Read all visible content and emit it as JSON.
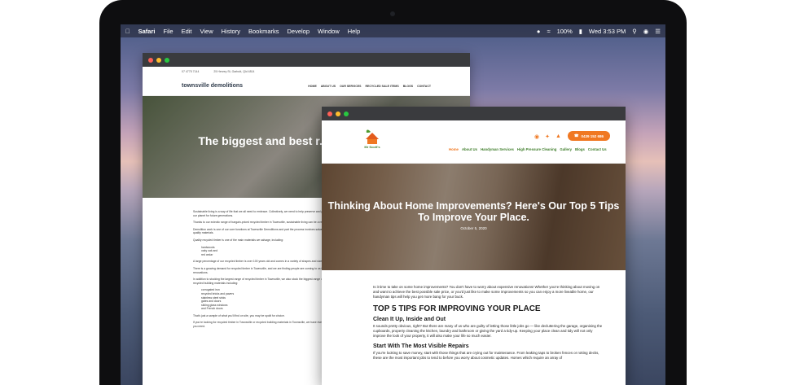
{
  "menubar": {
    "app": "Safari",
    "items": [
      "File",
      "Edit",
      "View",
      "History",
      "Bookmarks",
      "Develop",
      "Window",
      "Help"
    ],
    "battery": "100%",
    "clock": "Wed 3:53 PM"
  },
  "back_window": {
    "phone": "07 4775 7144",
    "address": "25 Hervey St, Garbutt, Qld 4814",
    "logo": "townsville demolitions",
    "nav": [
      "HOME",
      "ABOUT US",
      "OUR SERVICES",
      "RECYCLED SALE ITEMS",
      "BLOGS",
      "CONTACT"
    ],
    "hero_title": "The biggest and best r... timber in Tow...",
    "paragraphs": [
      "Sustainable living is a way of life that we all need to embrace. Collectively, we need to help preserve and protect our planet for future generations.",
      "Thanks to our eclectic range of bargain-priced recycled timber in Townsville, sustainable living can be a reality.",
      "Demolition work is one of our core functions at Townsville Demolitions and part the process involves salvaging quality materials.",
      "Quality recycled timber is one of the main materials we salvage, including:"
    ],
    "list1": [
      "hardwoods",
      "oaky oak and",
      "red cedar"
    ],
    "paragraphs2": [
      "A large percentage of our recycled timber is over 100 years old and comes in a variety of shapes and sizes.",
      "There is a growing demand for recycled timber in Townsville, and we are finding people are coming to us for new renovations.",
      "In addition to stocking the largest range of recycled timber in Townsville, we also stock the biggest range of recycled building materials including:"
    ],
    "list2": [
      "corrugated iron",
      "recycled bricks and pavers",
      "stainless steel sinks",
      "gates and doors",
      "sliding glass windows",
      "and French doors"
    ],
    "footer_text": "That's just a sample of what you'll find on site, you may be spoilt for choice.",
    "footer_text2": "If you're looking for recycled timber in Townsville or recycled building materials in Townsville, we have everything you need."
  },
  "front_window": {
    "logo_text": "Mr Scott's",
    "social_icons": [
      "instagram-icon",
      "twitter-icon",
      "houzz-icon"
    ],
    "phone": "0439 152 686",
    "nav": [
      "Home",
      "About Us",
      "Handyman Services",
      "High Pressure Cleaning",
      "Gallery",
      "Blogs",
      "Contact Us"
    ],
    "hero_title": "Thinking About Home Improvements? Here's Our Top 5 Tips To Improve Your Place.",
    "hero_date": "October 5, 2020",
    "intro": "Is it time to take on some home improvements? You don't have to worry about expensive renovations! Whether you're thinking about moving on and want to achieve the best possible sale price, or you'd just like to make some improvements so you can enjoy a more liveable home, our handyman tips will help you get more bang for your buck.",
    "h2": "TOP 5 TIPS FOR IMPROVING YOUR PLACE",
    "h3_1": "Clean It Up, Inside and Out",
    "p1": "It sounds pretty obvious, right? But there are many of us who are guilty of letting those little jobs go — like decluttering the garage, organising the cupboards, property cleaning the kitchen, laundry and bathroom or giving the yard a tidy-up. Keeping your place clean and tidy will not only improve the look of your property, it will also make your life so much easier.",
    "h3_2": "Start With The Most Visible Repairs",
    "p2": "If you're looking to save money, start with those things that are crying out for maintenance. From leaking taps to broken fences or rotting decks, these are the most important jobs to tend to before you worry about cosmetic updates. Homes which require an array of"
  },
  "colors": {
    "accent_orange": "#f07822",
    "nav_green": "#3e7d2a",
    "titlebar": "#3a3b3e"
  }
}
